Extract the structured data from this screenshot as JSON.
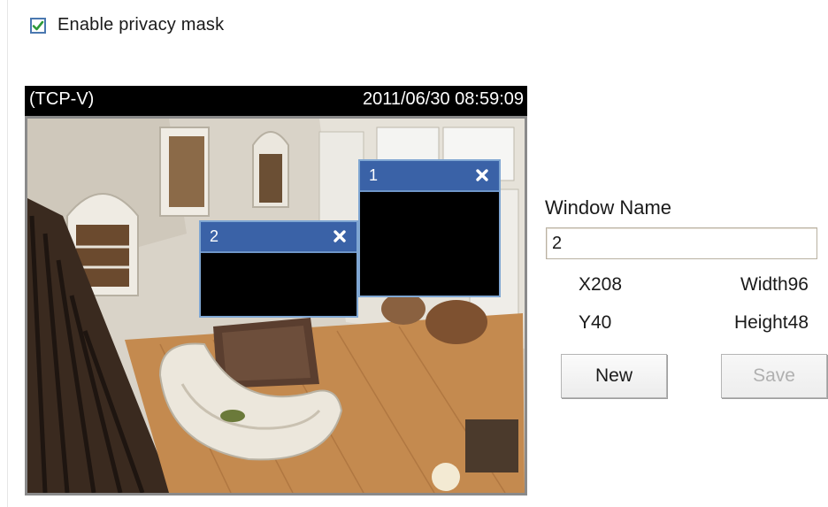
{
  "privacy_mask": {
    "enable_label": "Enable privacy mask",
    "enabled": true
  },
  "video": {
    "protocol": "(TCP-V)",
    "timestamp": "2011/06/30 08:59:09",
    "masks": [
      {
        "number": "1",
        "icon": "close-icon"
      },
      {
        "number": "2",
        "icon": "close-icon"
      }
    ]
  },
  "window_settings": {
    "name_label": "Window Name",
    "name_value": "2",
    "x": "X208",
    "y": "Y40",
    "width": "Width96",
    "height": "Height48"
  },
  "buttons": {
    "new_label": "New",
    "save_label": "Save",
    "save_disabled": true
  },
  "colors": {
    "mask_title": "#3a62a7",
    "mask_border": "#7fa6d2",
    "checkbox_check": "#2e9a3a"
  }
}
